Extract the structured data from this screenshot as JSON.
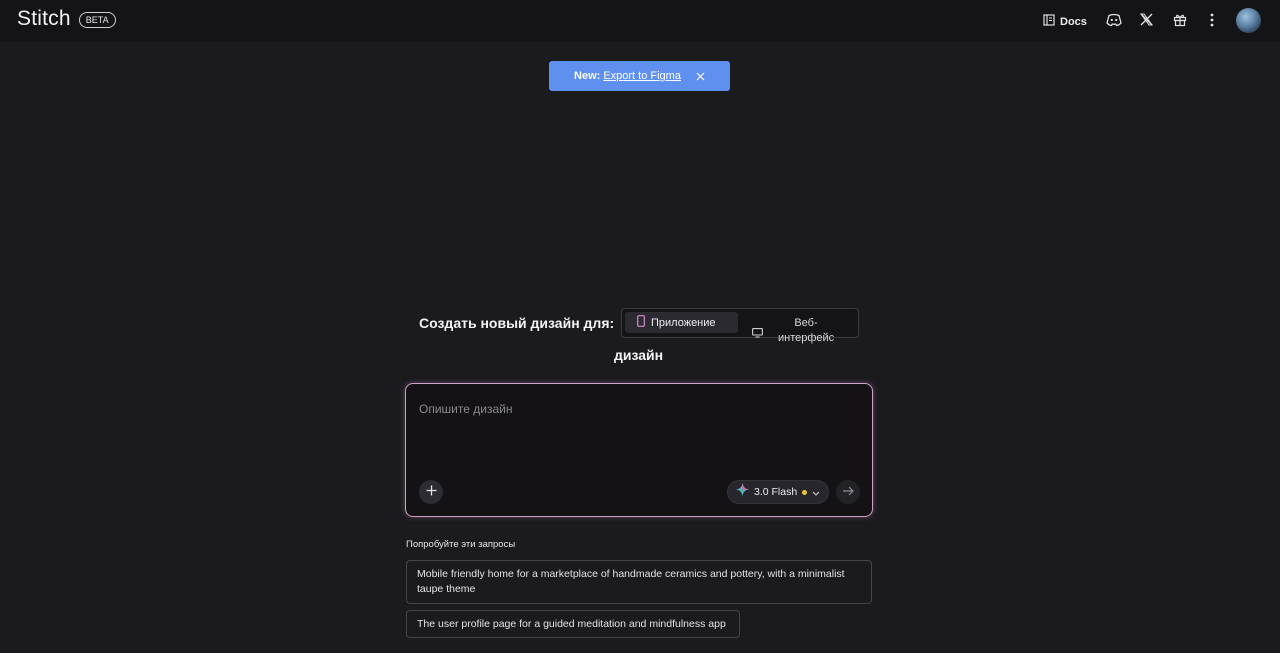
{
  "header": {
    "logo": "Stitch",
    "badge": "BETA",
    "docs_label": "Docs",
    "icons": [
      "docs-icon",
      "discord-icon",
      "x-icon",
      "gift-icon",
      "more-vert-icon"
    ]
  },
  "banner": {
    "prefix": "New:",
    "link": "Export to Figma"
  },
  "create": {
    "label_line1": "Создать новый дизайн для:",
    "label_line2": "дизайн",
    "options": {
      "app": "Приложение",
      "web": "Веб-интерфейс"
    },
    "selected": "app"
  },
  "prompt": {
    "placeholder": "Опишите дизайн",
    "model": "3.0 Flash"
  },
  "suggestions": {
    "title": "Попробуйте эти запросы",
    "items": [
      "Mobile friendly home for a marketplace of handmade ceramics and pottery, with a minimalist taupe theme",
      "The user profile page for a guided meditation and mindfulness app"
    ]
  },
  "colors": {
    "background": "#1b1b1e",
    "header": "#141416",
    "banner": "#5f8fef",
    "prompt_border": "#cfa3c7",
    "status_dot": "#f0c23a"
  }
}
